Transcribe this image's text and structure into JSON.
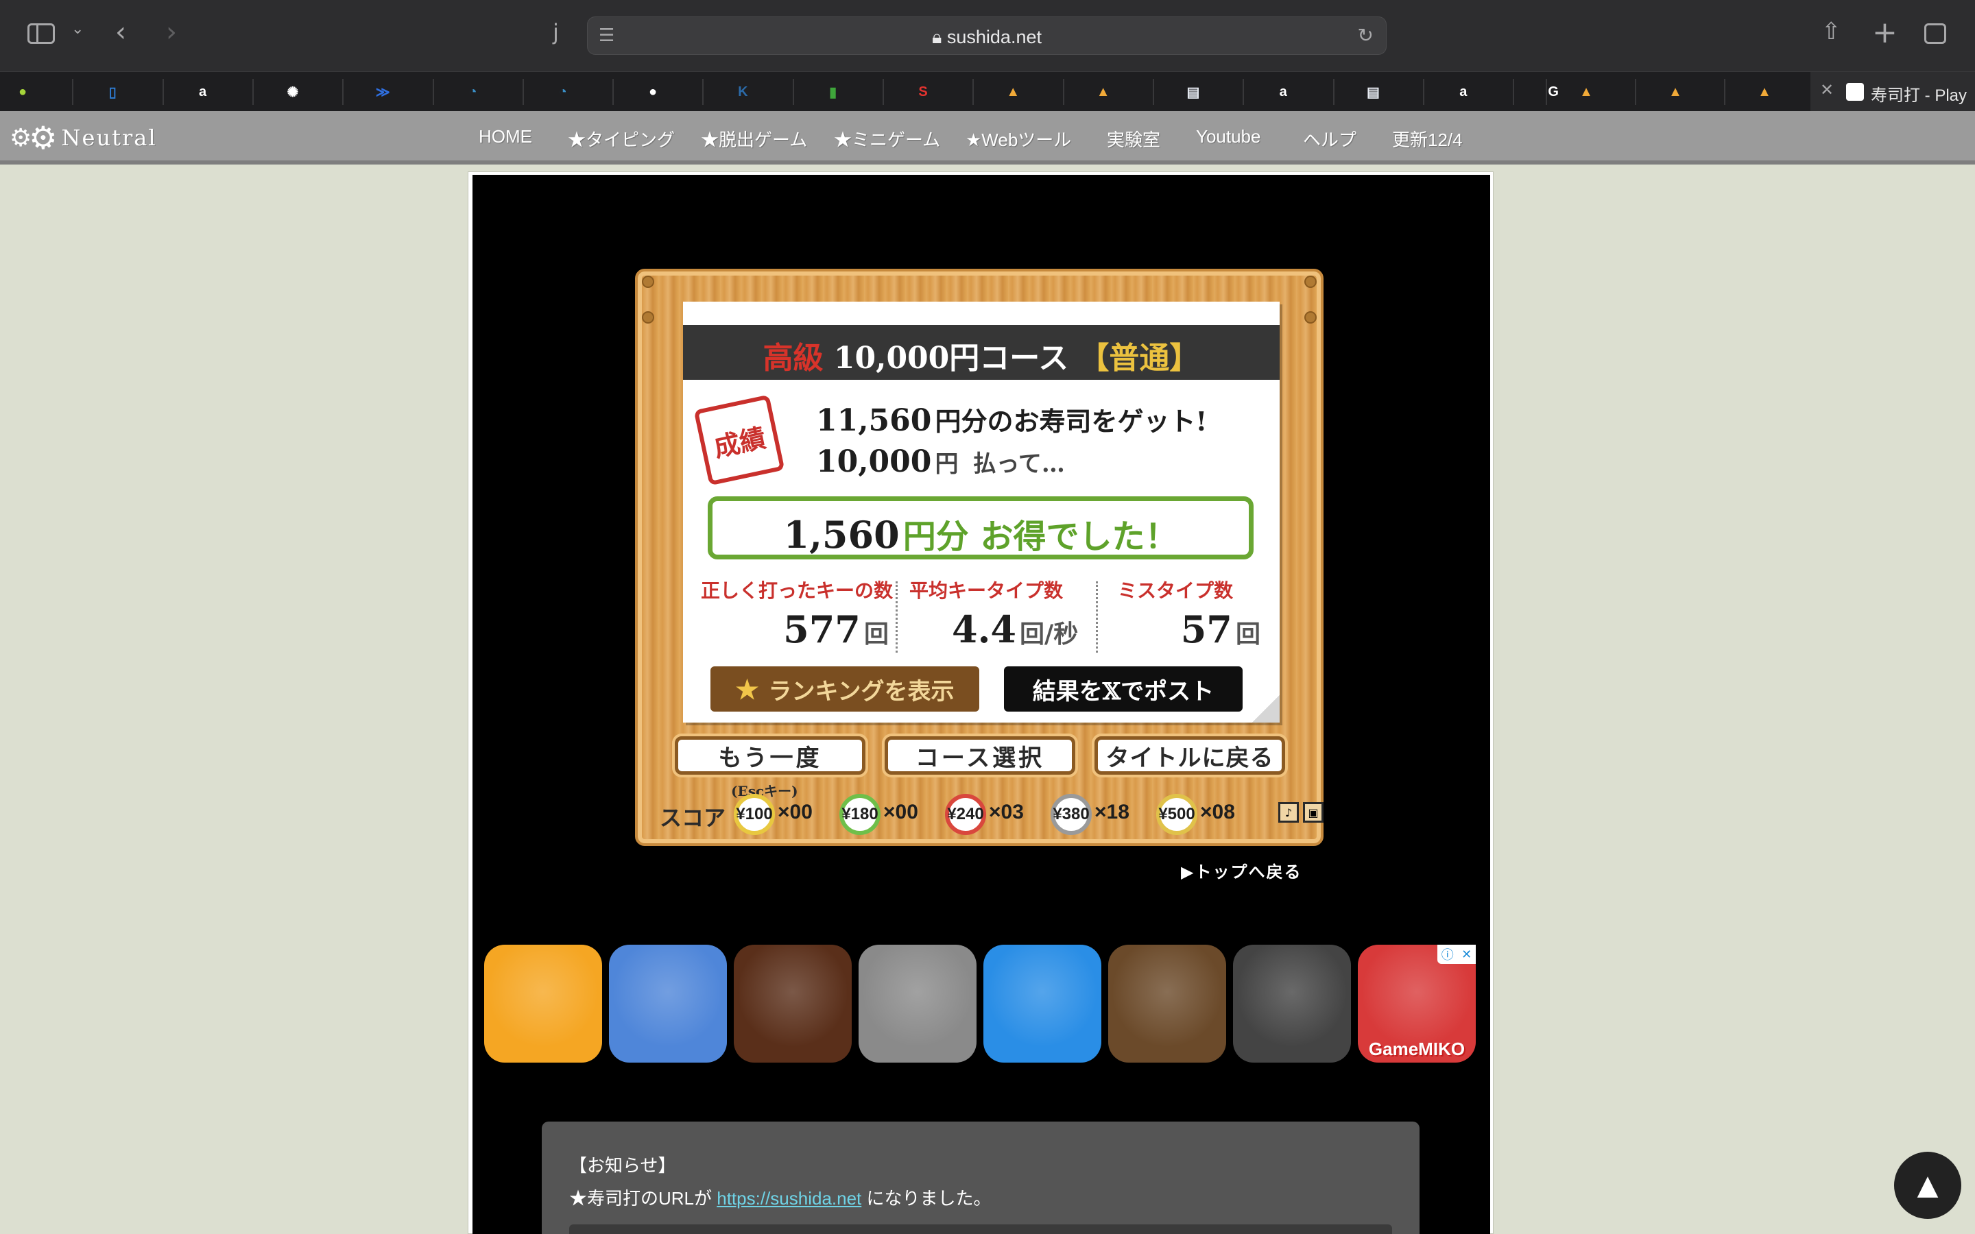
{
  "browser": {
    "url": "sushida.net",
    "reader_glyph": "j",
    "active_tab_title": "寿司打 - Play"
  },
  "favorites": [
    {
      "icon": "leaf-icon",
      "color": "#a6d53a"
    },
    {
      "icon": "book-icon",
      "color": "#2f7fd8"
    },
    {
      "icon": "amazon-icon",
      "color": "#ffffff"
    },
    {
      "icon": "openai-icon",
      "color": "#ffffff"
    },
    {
      "icon": "jira-icon",
      "color": "#2f6fe0"
    },
    {
      "icon": "swirl-icon",
      "color": "#3a8fc6"
    },
    {
      "icon": "swirl-icon",
      "color": "#3a8fc6"
    },
    {
      "icon": "github-icon",
      "color": "#ffffff"
    },
    {
      "icon": "k-icon",
      "color": "#2b6aa8"
    },
    {
      "icon": "bar-chart-icon",
      "color": "#3fa63b"
    },
    {
      "icon": "shazam-icon",
      "color": "#e3332f"
    },
    {
      "icon": "image-icon",
      "color": "#f0a938"
    },
    {
      "icon": "image-icon",
      "color": "#f0a938"
    },
    {
      "icon": "document-icon",
      "color": "#e9eef5"
    },
    {
      "icon": "amazon-icon",
      "color": "#ffffff"
    },
    {
      "icon": "document-icon",
      "color": "#e9eef5"
    },
    {
      "icon": "amazon-icon",
      "color": "#ffffff"
    },
    {
      "icon": "google-icon",
      "color": "#ffffff"
    },
    {
      "icon": "image-icon",
      "color": "#f0a938"
    },
    {
      "icon": "image-icon",
      "color": "#f0a938"
    },
    {
      "icon": "image-icon",
      "color": "#f0a938"
    }
  ],
  "site": {
    "logo": "Neutral",
    "nav": [
      "HOME",
      "★タイピング",
      "★脱出ゲーム",
      "★ミニゲーム",
      "★Webツール",
      "実験室",
      "Youtube",
      "ヘルプ",
      "更新12/4"
    ]
  },
  "result": {
    "course_grade": "高級",
    "course_price": "10,000円コース",
    "course_difficulty": "【普通】",
    "stamp": "成績",
    "earned_amount": "11,560",
    "earned_text": "円分のお寿司をゲット!",
    "paid_amount": "10,000",
    "paid_unit": "円",
    "paid_text": "払って…",
    "gain_amount": "1,560",
    "gain_text": "円分 お得でした！",
    "stats": [
      {
        "label": "正しく打ったキーの数",
        "value": "577",
        "unit": "回"
      },
      {
        "label": "平均キータイプ数",
        "value": "4.4",
        "unit": "回/秒"
      },
      {
        "label": "ミスタイプ数",
        "value": "57",
        "unit": "回"
      }
    ],
    "ranking_button": "ランキングを表示",
    "post_button": "結果を𝕏でポスト",
    "retry_button": "もう一度",
    "course_select_button": "コース選択",
    "title_button": "タイトルに戻る",
    "esc_hint": "(Escキー)",
    "score_label": "スコア",
    "plates": [
      {
        "price": "¥100",
        "count": "×00",
        "ring": "#e8c840"
      },
      {
        "price": "¥180",
        "count": "×00",
        "ring": "#6fbf4a"
      },
      {
        "price": "¥240",
        "count": "×03",
        "ring": "#d9473d"
      },
      {
        "price": "¥380",
        "count": "×18",
        "ring": "#9a9a9a"
      },
      {
        "price": "¥500",
        "count": "×08",
        "ring": "#e0c24a"
      }
    ],
    "top_link": "▶トップへ戻る"
  },
  "ads": [
    {
      "name": "red-ball-icon",
      "bg": "#f5a623"
    },
    {
      "name": "snake-icon",
      "bg": "#4f86d9"
    },
    {
      "name": "fnaf-icon",
      "bg": "#5a2f1a"
    },
    {
      "name": "gta-icon",
      "bg": "#8a8a8a"
    },
    {
      "name": "fish-icon",
      "bg": "#2a8ee6"
    },
    {
      "name": "minecraft-icon",
      "bg": "#6b4a2a"
    },
    {
      "name": "granny-icon",
      "bg": "#444444"
    },
    {
      "name": "kick-buddy-icon",
      "bg": "#d83a3a"
    }
  ],
  "ad_brand": "GameMIKO",
  "notice": {
    "title": "【お知らせ】",
    "body_prefix": "★寿司打のURLが",
    "link": "https://sushida.net",
    "body_suffix": "になりました。"
  }
}
